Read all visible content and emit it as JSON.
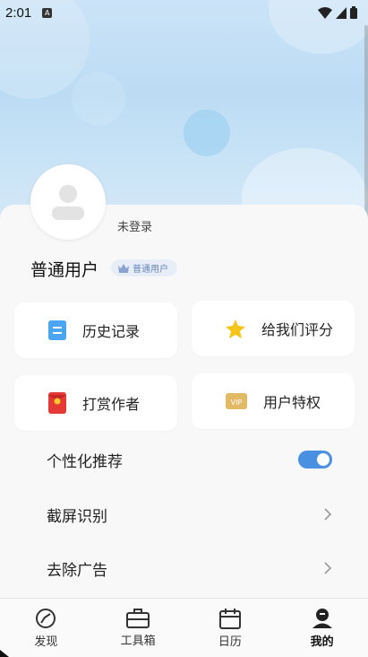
{
  "status_bar": {
    "time": "2:01",
    "icons": [
      "notification-icon",
      "wifi-icon",
      "signal-icon",
      "battery-icon"
    ]
  },
  "profile": {
    "login_label": "未登录",
    "user_type": "普通用户",
    "user_badge": "普通用户"
  },
  "quick_tiles": [
    {
      "label": "历史记录",
      "icon": "history-icon"
    },
    {
      "label": "给我们评分",
      "icon": "star-icon"
    },
    {
      "label": "打赏作者",
      "icon": "red-envelope-icon"
    },
    {
      "label": "用户特权",
      "icon": "vip-icon"
    }
  ],
  "settings": [
    {
      "label": "个性化推荐",
      "control": "toggle",
      "enabled": true
    },
    {
      "label": "截屏识别",
      "control": "chevron"
    },
    {
      "label": "去除广告",
      "control": "chevron"
    }
  ],
  "tabbar": [
    {
      "label": "发现",
      "icon": "compass-icon",
      "active": false
    },
    {
      "label": "工具箱",
      "icon": "toolbox-icon",
      "active": false
    },
    {
      "label": "日历",
      "icon": "calendar-icon",
      "active": false
    },
    {
      "label": "我的",
      "icon": "profile-icon",
      "active": true
    }
  ],
  "colors": {
    "accent": "#4a90e2",
    "hero_bg": "#c6e0f5",
    "badge_text": "#6a85b8"
  }
}
